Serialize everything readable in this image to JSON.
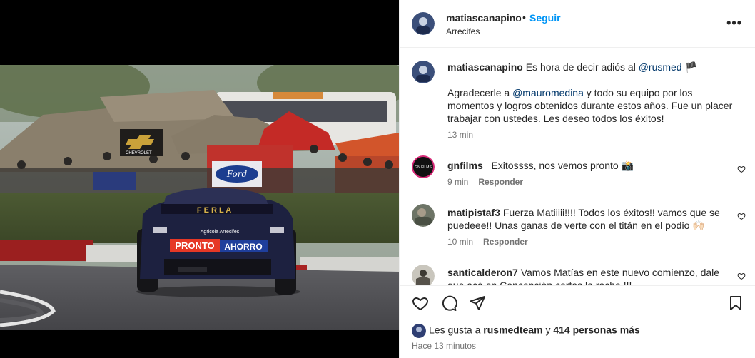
{
  "post": {
    "username": "matiascanapino",
    "follow_label": "Seguir",
    "location": "Arrecifes",
    "more_label": "•••"
  },
  "photo": {
    "sponsor_logo_text": "PRONTO AHORRO",
    "sponsor_pronto": "PRONTO",
    "sponsor_ahorro": "AHORRO",
    "car_text": "Agricola Arrecifes",
    "banner_chevrolet": "CHEVROLET",
    "banner_ford": "Ford"
  },
  "caption": {
    "username": "matiascanapino",
    "line1_text": "Es hora de decir adiós al",
    "mention1": "@rusmed",
    "flag_emoji": "🏴",
    "p2_prefix": "Agradecerle a",
    "mention2": "@mauromedina",
    "p2_rest": "y todo su equipo por los momentos y logros obtenidos durante estos años. Fue un placer trabajar con ustedes. Les deseo todos los éxitos!",
    "time": "13 min"
  },
  "comments": [
    {
      "username": "gnfilms_",
      "text": "Exitossss, nos vemos pronto 📸",
      "time": "9 min",
      "reply": "Responder",
      "avatar_text": "GN FILMS"
    },
    {
      "username": "matipistaf3",
      "text": "Fuerza Matiiiii!!!! Todos los éxitos!! vamos que se puedeee!! Unas ganas de verte con el titán en el podio 🙌🏻",
      "time": "10 min",
      "reply": "Responder"
    },
    {
      "username": "santicalderon7",
      "text": "Vamos Matías en este nuevo comienzo, dale que acá en Concepción cortas la racha !!!",
      "time": "",
      "reply": ""
    }
  ],
  "likes": {
    "prefix": "Les gusta a",
    "user": "rusmedteam",
    "middle": "y",
    "count_text": "414 personas más"
  },
  "posted_ago": "Hace 13 minutos",
  "colors": {
    "link_blue": "#0095f6",
    "mention": "#00376b",
    "secondary": "#737373"
  }
}
